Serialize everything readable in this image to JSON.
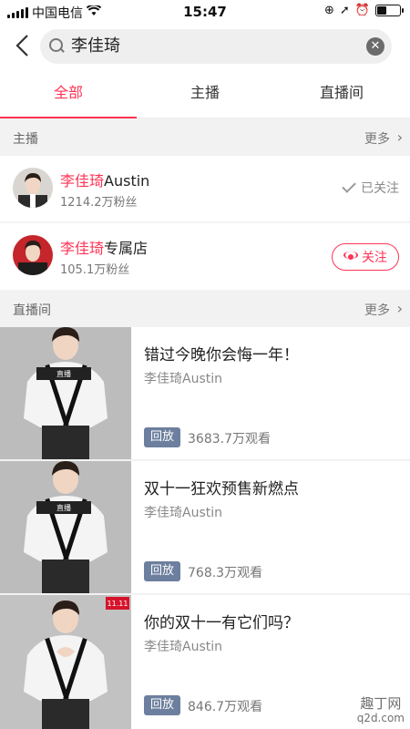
{
  "status_bar": {
    "carrier": "中国电信",
    "time": "15:47"
  },
  "search": {
    "query": "李佳琦",
    "back_icon": "back-chevron-icon",
    "search_icon": "search-icon",
    "clear_icon": "clear-icon"
  },
  "tabs": [
    {
      "label": "全部",
      "active": true
    },
    {
      "label": "主播",
      "active": false
    },
    {
      "label": "直播间",
      "active": false
    }
  ],
  "anchors_section": {
    "title": "主播",
    "more": "更多"
  },
  "anchors": [
    {
      "highlight": "李佳琦",
      "suffix": "Austin",
      "fans": "1214.2万粉丝",
      "action": "已关注"
    },
    {
      "highlight": "李佳琦",
      "suffix": "专属店",
      "fans": "105.1万粉丝",
      "action": "关注"
    }
  ],
  "live_section": {
    "title": "直播间",
    "more": "更多"
  },
  "live_rooms": [
    {
      "title": "错过今晚你会悔一年！",
      "author": "李佳琦Austin",
      "badge": "回放",
      "views": "3683.7万观看"
    },
    {
      "title": "双十一狂欢预售新燃点",
      "author": "李佳琦Austin",
      "badge": "回放",
      "views": "768.3万观看"
    },
    {
      "title": "你的双十一有它们吗？",
      "author": "李佳琦Austin",
      "badge": "回放",
      "views": "846.7万观看"
    }
  ],
  "watermark": {
    "line1": "趣丁网",
    "line2": "q2d.com"
  },
  "colors": {
    "accent": "#ff3355",
    "badge": "#6d7f9e"
  }
}
